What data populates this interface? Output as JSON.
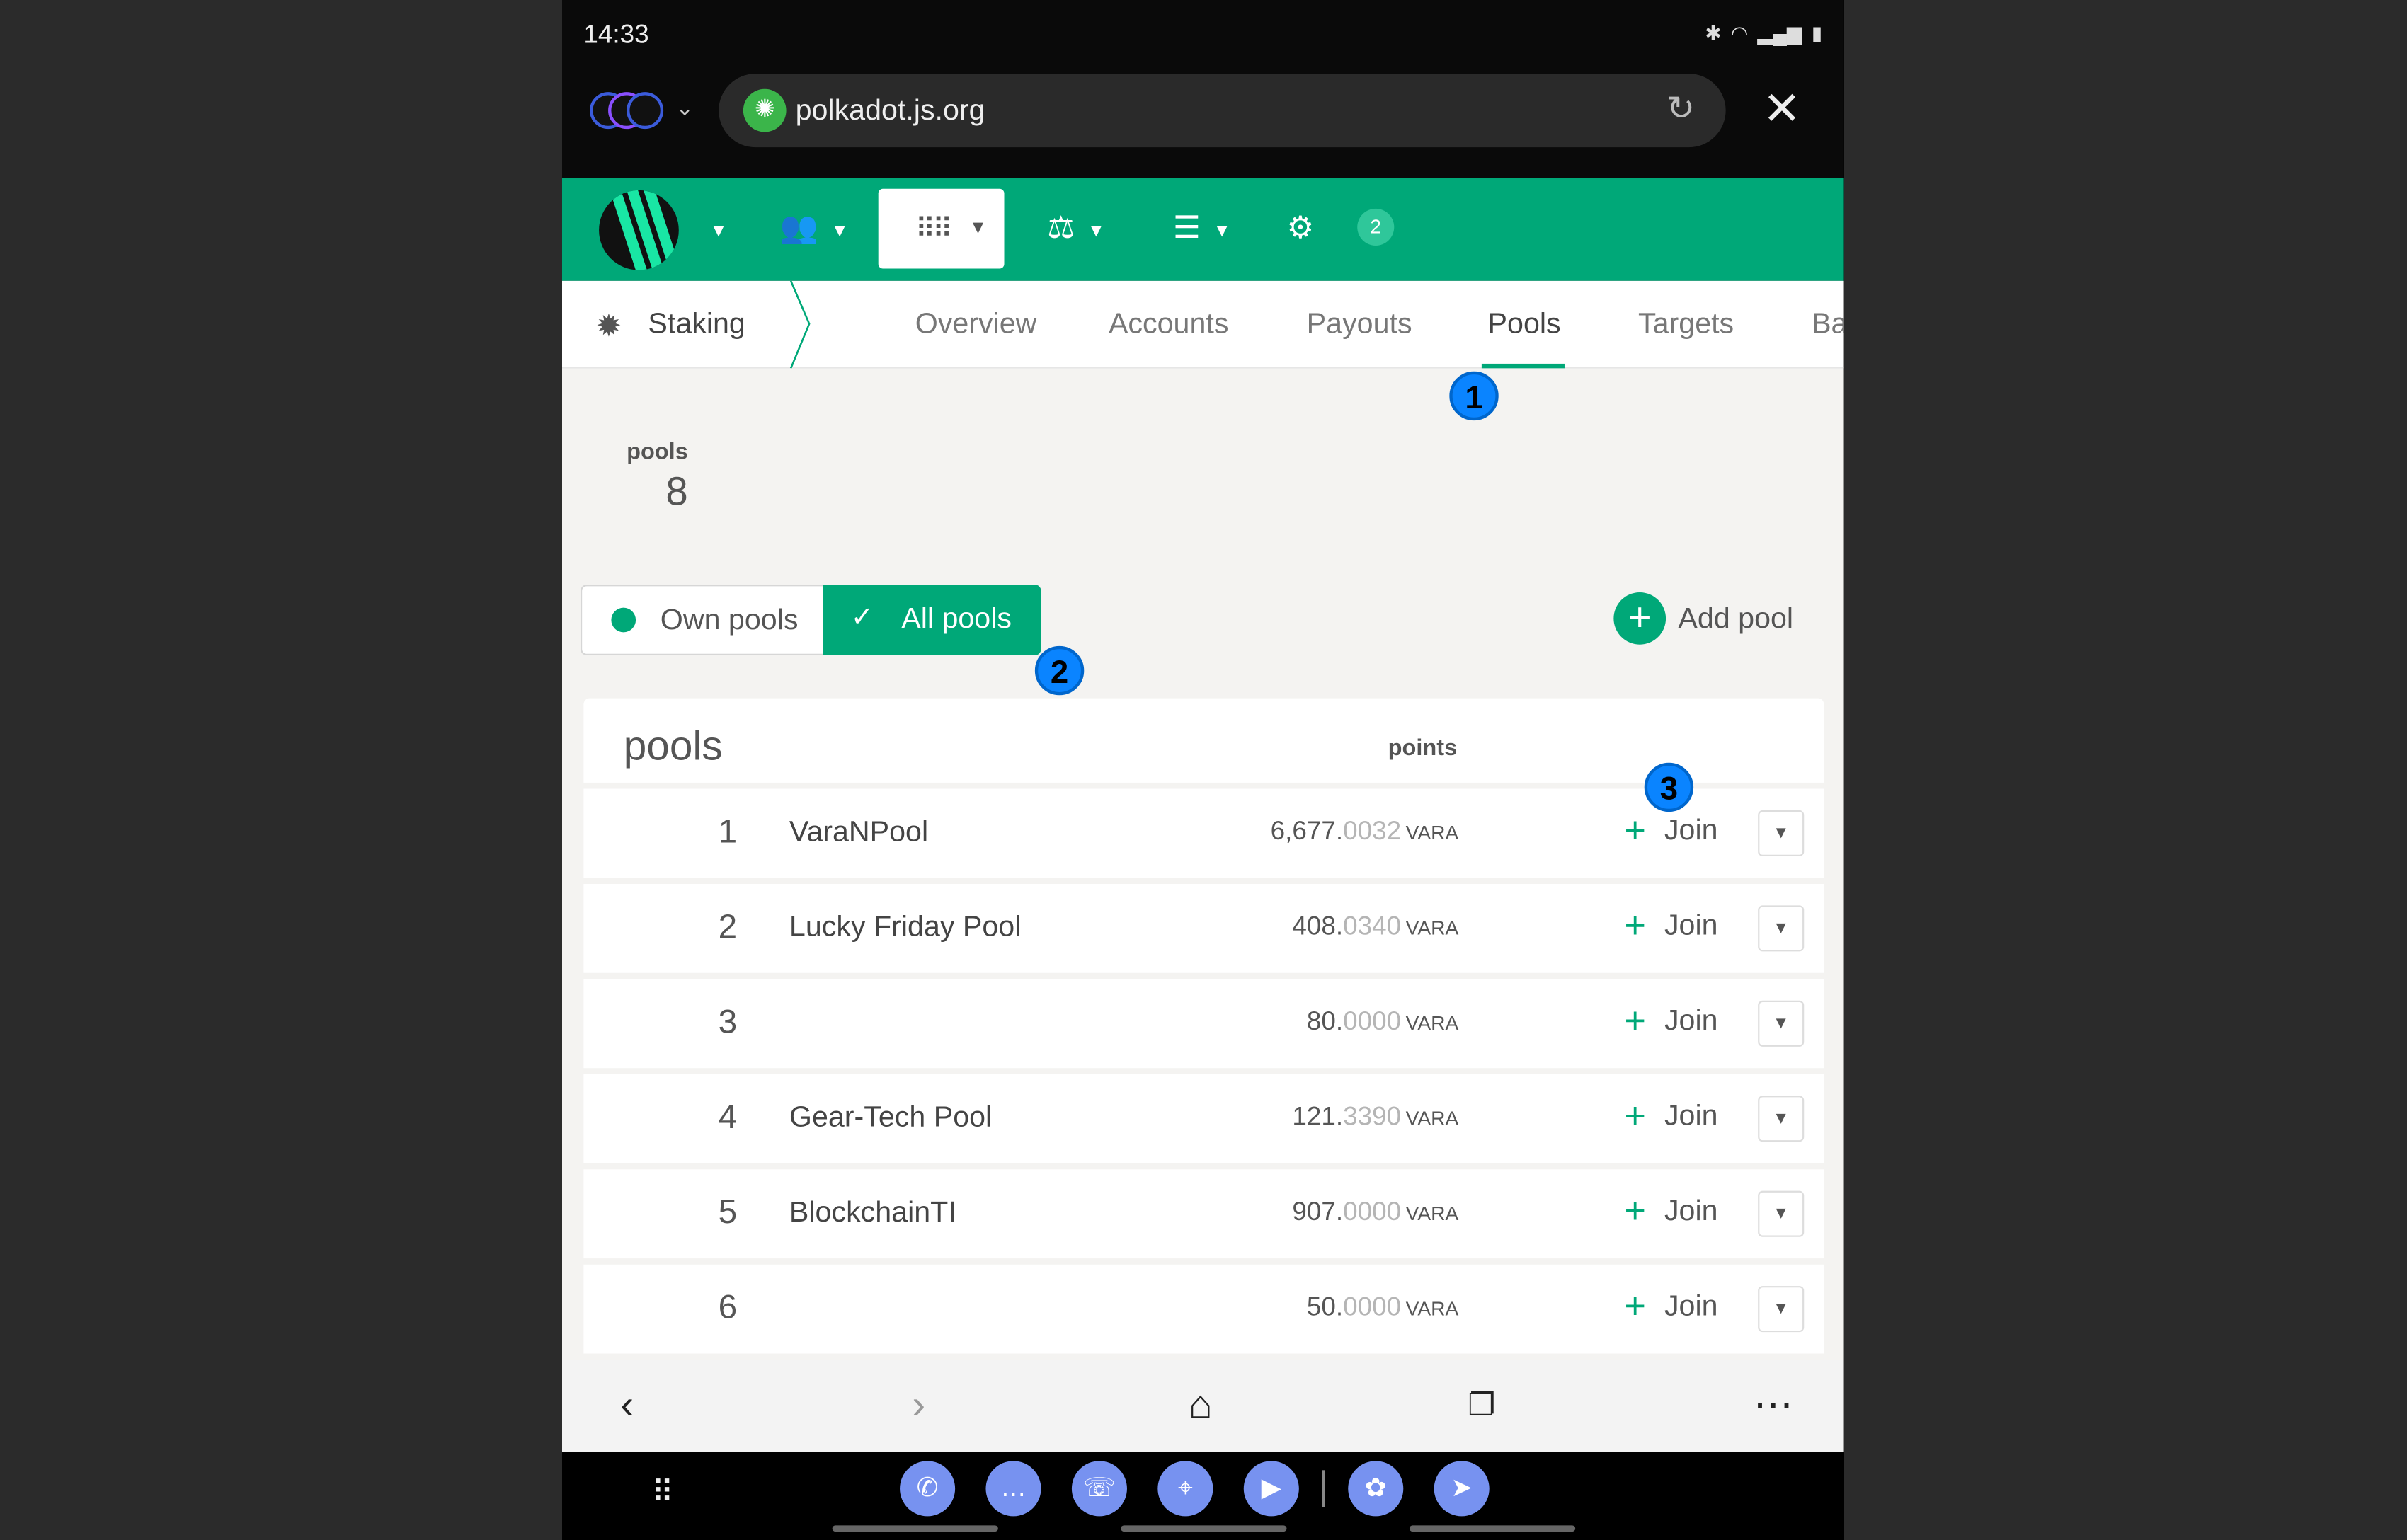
{
  "status": {
    "time": "14:33"
  },
  "browser": {
    "url": "polkadot.js.org"
  },
  "header": {
    "badge": "2"
  },
  "tabs": {
    "section": "Staking",
    "items": [
      {
        "label": "Overview"
      },
      {
        "label": "Accounts"
      },
      {
        "label": "Payouts"
      },
      {
        "label": "Pools"
      },
      {
        "label": "Targets"
      },
      {
        "label": "Ba"
      }
    ],
    "active": "Pools"
  },
  "summary": {
    "label": "pools",
    "value": "8"
  },
  "filters": {
    "own_label": "Own pools",
    "all_label": "All pools",
    "selected": "All pools"
  },
  "add_pool_label": "Add pool",
  "table": {
    "title": "pools",
    "points_header": "points",
    "join_label": "Join",
    "rows": [
      {
        "index": "1",
        "name": "VaraNPool",
        "points_int": "6,677.",
        "points_frac": "0032",
        "unit": "VARA"
      },
      {
        "index": "2",
        "name": "Lucky Friday Pool",
        "points_int": "408.",
        "points_frac": "0340",
        "unit": "VARA"
      },
      {
        "index": "3",
        "name": "",
        "points_int": "80.",
        "points_frac": "0000",
        "unit": "VARA"
      },
      {
        "index": "4",
        "name": "Gear-Tech Pool",
        "points_int": "121.",
        "points_frac": "3390",
        "unit": "VARA"
      },
      {
        "index": "5",
        "name": "BlockchainTI",
        "points_int": "907.",
        "points_frac": "0000",
        "unit": "VARA"
      },
      {
        "index": "6",
        "name": "",
        "points_int": "50.",
        "points_frac": "0000",
        "unit": "VARA"
      }
    ]
  },
  "markers": [
    "1",
    "2",
    "3"
  ],
  "colors": {
    "accent": "#00a878",
    "marker": "#0a84ff"
  }
}
